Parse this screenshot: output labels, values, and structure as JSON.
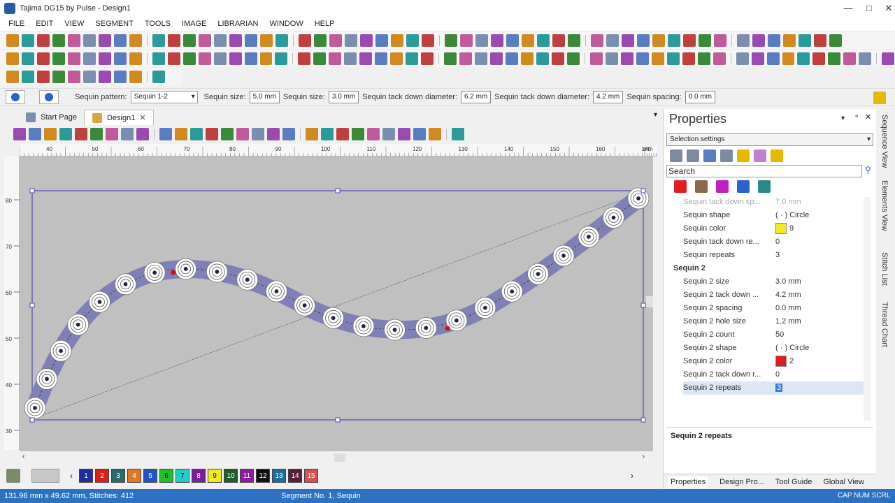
{
  "window": {
    "title": "Tajima DG15 by Pulse - Design1"
  },
  "menu": [
    "FILE",
    "EDIT",
    "VIEW",
    "SEGMENT",
    "TOOLS",
    "IMAGE",
    "LIBRARIAN",
    "WINDOW",
    "HELP"
  ],
  "sequin_bar": {
    "pattern_label": "Sequin pattern:",
    "pattern_value": "Sequin 1-2",
    "size1_label": "Sequin size:",
    "size1_value": "5.0 mm",
    "size2_label": "Sequin size:",
    "size2_value": "3.0 mm",
    "tack1_label": "Sequin tack down diameter:",
    "tack1_value": "6.2 mm",
    "tack2_label": "Sequin tack down diameter:",
    "tack2_value": "4.2 mm",
    "spacing_label": "Sequin spacing:",
    "spacing_value": "0.0 mm"
  },
  "tabs": [
    {
      "label": "Start Page"
    },
    {
      "label": "Design1"
    }
  ],
  "ruler": {
    "top": [
      "40",
      "50",
      "60",
      "70",
      "80",
      "90",
      "100",
      "110",
      "120",
      "130",
      "140",
      "150",
      "160",
      "170",
      "mm"
    ],
    "left": [
      "80",
      "70",
      "60",
      "50",
      "40",
      "30"
    ]
  },
  "palette": [
    "1",
    "2",
    "3",
    "4",
    "5",
    "6",
    "7",
    "8",
    "9",
    "10",
    "11",
    "12",
    "13",
    "14",
    "15"
  ],
  "palette_colors": [
    "#1e2ea0",
    "#d8201c",
    "#2a6a6a",
    "#e07a20",
    "#1e55c8",
    "#1fbf2a",
    "#20d0c8",
    "#7a1e9c",
    "#f2ea20",
    "#1e5e2a",
    "#8a1ea0",
    "#111111",
    "#1e6e9c",
    "#5a1e3a",
    "#d85050"
  ],
  "status": {
    "left": "131.96 mm x 49.62 mm, Stitches: 412",
    "center": "Segment No. 1, Sequin",
    "right": "CAP  NUM  SCRL"
  },
  "properties": {
    "title": "Properties",
    "selector": "Selection settings",
    "search_placeholder": "Search",
    "rows": [
      {
        "name": "Sequin tack down sp...",
        "value": "7.0 mm",
        "faded": true
      },
      {
        "name": "Sequin shape",
        "value": "Circle",
        "shape": true
      },
      {
        "name": "Sequin color",
        "value": "9",
        "color": "#f2ea20"
      },
      {
        "name": "Sequin tack down re...",
        "value": "0"
      },
      {
        "name": "Sequin repeats",
        "value": "3"
      },
      {
        "name": "Sequin 2",
        "value": "",
        "group": true
      },
      {
        "name": "Sequin 2 size",
        "value": "3.0 mm"
      },
      {
        "name": "Sequin 2 tack down ...",
        "value": "4.2 mm"
      },
      {
        "name": "Sequin 2 spacing",
        "value": "0.0 mm"
      },
      {
        "name": "Sequin 2 hole size",
        "value": "1.2 mm"
      },
      {
        "name": "Sequin 2 count",
        "value": "50"
      },
      {
        "name": "Sequin 2 shape",
        "value": "Circle",
        "shape": true
      },
      {
        "name": "Sequin 2 color",
        "value": "2",
        "color": "#d8201c"
      },
      {
        "name": "Sequin 2 tack down r...",
        "value": "0"
      },
      {
        "name": "Sequin 2 repeats",
        "value": "3",
        "selected": true
      }
    ],
    "description": "Sequin 2 repeats",
    "bottom_tabs": [
      "Properties",
      "Design Pro...",
      "Tool Guide",
      "Global View"
    ]
  },
  "side_tabs": [
    "Sequence View",
    "Elements View",
    "Stitch List",
    "Thread Chart"
  ]
}
